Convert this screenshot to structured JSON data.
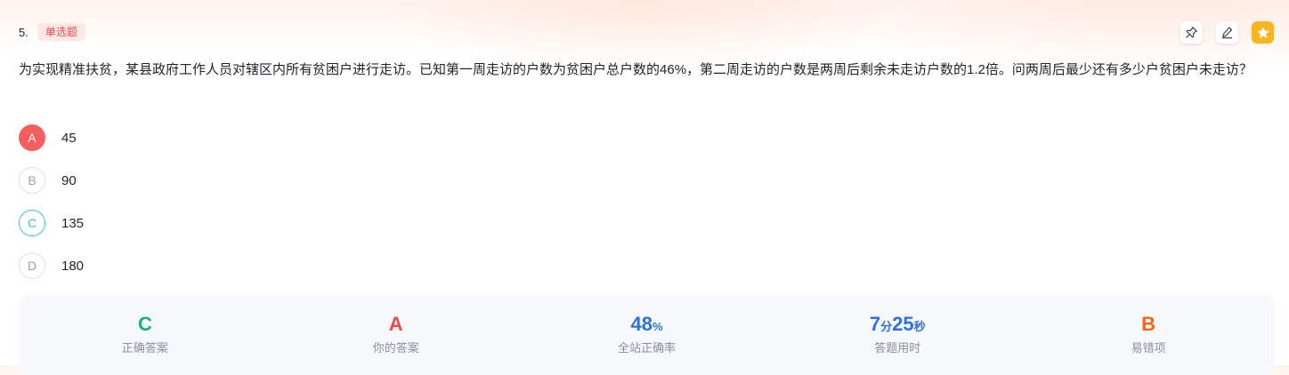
{
  "question": {
    "number": "5.",
    "type_label": "单选题",
    "text": "为实现精准扶贫，某县政府工作人员对辖区内所有贫困户进行走访。已知第一周走访的户数为贫困户总户数的46%，第二周走访的户数是两周后剩余未走访户数的1.2倍。问两周后最少还有多少户贫困户未走访？"
  },
  "toolbar": {
    "icons": [
      "pin-icon",
      "edit-icon",
      "star-icon"
    ],
    "star_color": "#f9b520"
  },
  "options": [
    {
      "letter": "A",
      "text": "45",
      "state": "wrong"
    },
    {
      "letter": "B",
      "text": "90",
      "state": "normal"
    },
    {
      "letter": "C",
      "text": "135",
      "state": "correct"
    },
    {
      "letter": "D",
      "text": "180",
      "state": "normal"
    }
  ],
  "stats": {
    "correct_answer": {
      "value": "C",
      "label": "正确答案",
      "color": "#19b27b"
    },
    "your_answer": {
      "value": "A",
      "label": "你的答案",
      "color": "#f04848"
    },
    "accuracy": {
      "value": "48",
      "unit": "%",
      "label": "全站正确率",
      "color": "#2f6fe0"
    },
    "time_spent": {
      "minutes": "7",
      "min_unit": "分",
      "seconds": "25",
      "sec_unit": "秒",
      "label": "答题用时",
      "color": "#2f6fe0"
    },
    "common_mistake": {
      "value": "B",
      "label": "易错项",
      "color": "#f2661b"
    }
  }
}
